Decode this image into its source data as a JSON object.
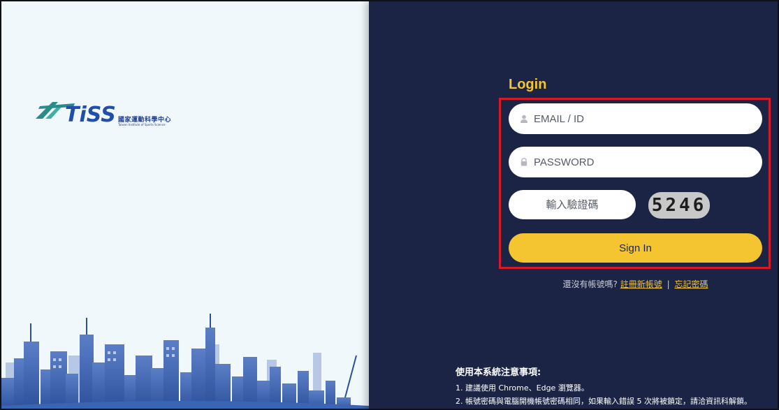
{
  "brand": {
    "logo_text": "TiSS",
    "name_cn": "國家運動科學中心",
    "name_en": "Taiwan Institute of Sports Science"
  },
  "login": {
    "title": "Login",
    "email_placeholder": "EMAIL / ID",
    "password_placeholder": "PASSWORD",
    "captcha_placeholder": "輸入驗證碼",
    "captcha_code": "5246",
    "signin_label": "Sign In"
  },
  "links": {
    "prompt": "還沒有帳號嗎?",
    "register": "註冊新帳號",
    "separator": "|",
    "forgot": "忘記密碼"
  },
  "notes": {
    "title": "使用本系統注意事項:",
    "items": [
      "1. 建議使用 Chrome、Edge 瀏覽器。",
      "2. 帳號密碼與電腦開機帳號密碼相同，如果輸入錯誤 5 次將被鎖定，請洽資訊科解鎖。"
    ]
  },
  "colors": {
    "accent": "#f4c531",
    "panel": "#1b2444",
    "highlight": "#d71a28",
    "left_bg": "#f1f8fb"
  }
}
